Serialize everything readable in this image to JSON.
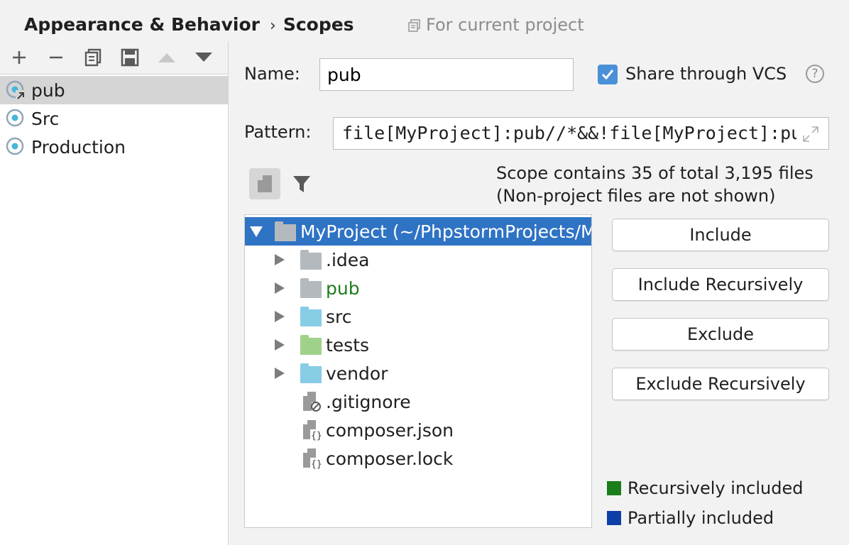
{
  "header": {
    "breadcrumb_parent": "Appearance & Behavior",
    "breadcrumb_sep": "›",
    "breadcrumb_current": "Scopes",
    "project_note": "For current project"
  },
  "toolbar": {
    "icons": [
      "add-icon",
      "remove-icon",
      "copy-icon",
      "save-icon",
      "move-up-icon",
      "move-down-icon"
    ]
  },
  "scopes": [
    {
      "label": "pub",
      "selected": true
    },
    {
      "label": "Src",
      "selected": false
    },
    {
      "label": "Production",
      "selected": false
    }
  ],
  "form": {
    "name_label": "Name:",
    "name_value": "pub",
    "share_checked": true,
    "share_label": "Share through VCS",
    "help": "?",
    "pattern_label": "Pattern:",
    "pattern_value": "file[MyProject]:pub//*&&!file[MyProject]:pub/index.php"
  },
  "scope_info": {
    "line1": "Scope contains 35 of total 3,195 files",
    "line2": "(Non-project files are not shown)"
  },
  "tree": {
    "root": "MyProject (~/PhpstormProjects/MyProject)",
    "items": [
      {
        "label": ".idea",
        "kind": "folder",
        "color": "#b4b9be",
        "label_color": "#1f1f1f"
      },
      {
        "label": "pub",
        "kind": "folder",
        "color": "#b4b9be",
        "label_color": "#1f7d1f"
      },
      {
        "label": "src",
        "kind": "folder",
        "color": "#87cde6",
        "label_color": "#1f1f1f"
      },
      {
        "label": "tests",
        "kind": "folder",
        "color": "#9fd18b",
        "label_color": "#1f1f1f"
      },
      {
        "label": "vendor",
        "kind": "folder",
        "color": "#87cde6",
        "label_color": "#1f1f1f"
      },
      {
        "label": ".gitignore",
        "kind": "ignore-file",
        "label_color": "#1f1f1f"
      },
      {
        "label": "composer.json",
        "kind": "json-file",
        "label_color": "#1f1f1f"
      },
      {
        "label": "composer.lock",
        "kind": "json-file",
        "label_color": "#1f1f1f"
      }
    ]
  },
  "buttons": {
    "include": "Include",
    "include_recursively": "Include Recursively",
    "exclude": "Exclude",
    "exclude_recursively": "Exclude Recursively"
  },
  "legend": {
    "recursive": {
      "label": "Recursively included",
      "color": "#1a7d1a"
    },
    "partial": {
      "label": "Partially included",
      "color": "#0e3ea8"
    }
  },
  "colors": {
    "selection": "#2f73c4",
    "checkbox": "#4a90d9"
  }
}
